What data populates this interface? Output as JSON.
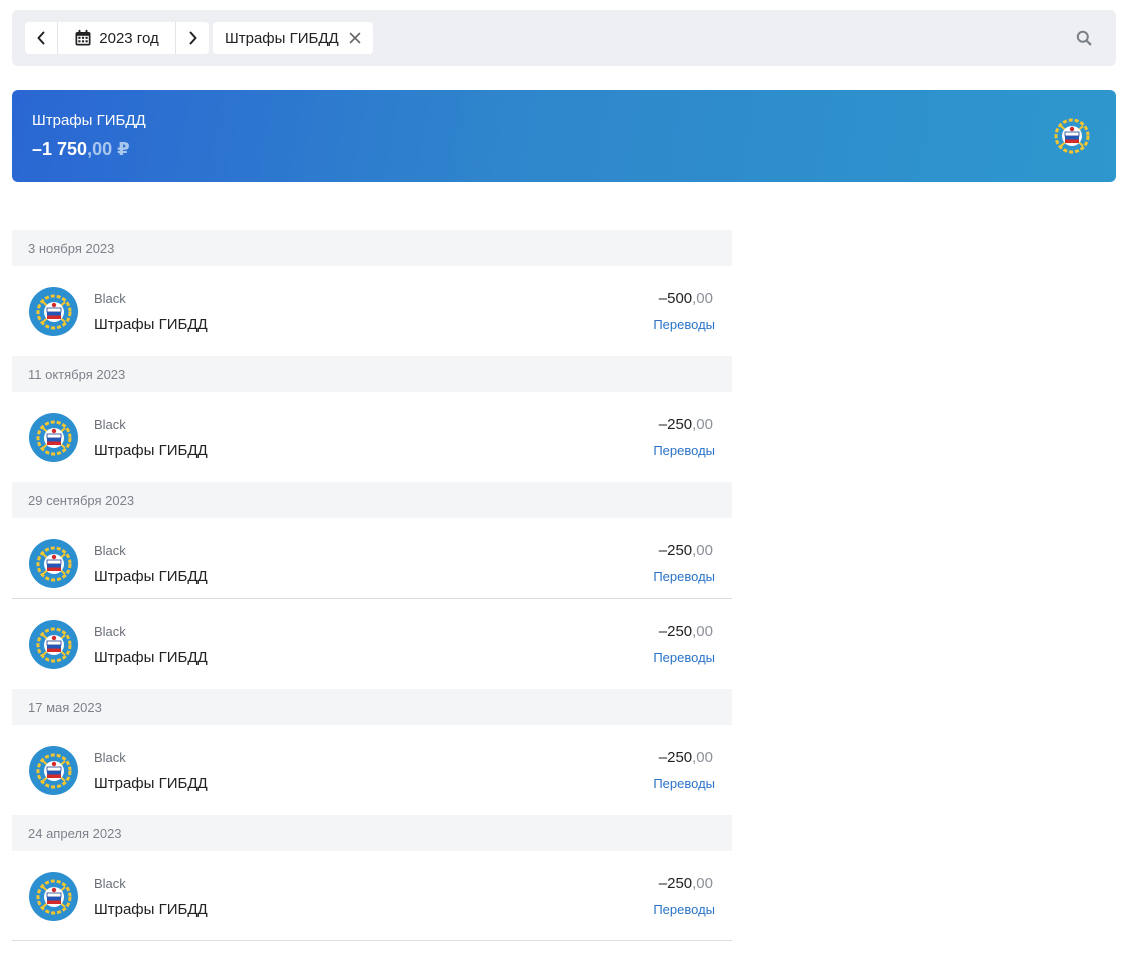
{
  "filter": {
    "year_label": "2023 год",
    "chip_label": "Штрафы ГИБДД"
  },
  "banner": {
    "title": "Штрафы ГИБДД",
    "amount_int": "–1 750",
    "amount_frac": ",00 ₽"
  },
  "groups": [
    {
      "date": "3 ноября 2023",
      "items": [
        {
          "card": "Black",
          "title": "Штрафы ГИБДД",
          "amount_int": "–500",
          "amount_frac": ",00",
          "category": "Переводы"
        }
      ]
    },
    {
      "date": "11 октября 2023",
      "items": [
        {
          "card": "Black",
          "title": "Штрафы ГИБДД",
          "amount_int": "–250",
          "amount_frac": ",00",
          "category": "Переводы"
        }
      ]
    },
    {
      "date": "29 сентября 2023",
      "items": [
        {
          "card": "Black",
          "title": "Штрафы ГИБДД",
          "amount_int": "–250",
          "amount_frac": ",00",
          "category": "Переводы"
        },
        {
          "card": "Black",
          "title": "Штрафы ГИБДД",
          "amount_int": "–250",
          "amount_frac": ",00",
          "category": "Переводы"
        }
      ]
    },
    {
      "date": "17 мая 2023",
      "items": [
        {
          "card": "Black",
          "title": "Штрафы ГИБДД",
          "amount_int": "–250",
          "amount_frac": ",00",
          "category": "Переводы"
        }
      ]
    },
    {
      "date": "24 апреля 2023",
      "items": [
        {
          "card": "Black",
          "title": "Штрафы ГИБДД",
          "amount_int": "–250",
          "amount_frac": ",00",
          "category": "Переводы"
        }
      ]
    }
  ],
  "colors": {
    "accent_link": "#2a73c8",
    "banner_start": "#2a66d3",
    "banner_end": "#2e97cd",
    "avatar_bg": "#2c8fd0"
  },
  "icons": [
    "chevron-left-icon",
    "calendar-icon",
    "chevron-right-icon",
    "close-icon",
    "search-icon",
    "gibdd-emblem-icon"
  ]
}
